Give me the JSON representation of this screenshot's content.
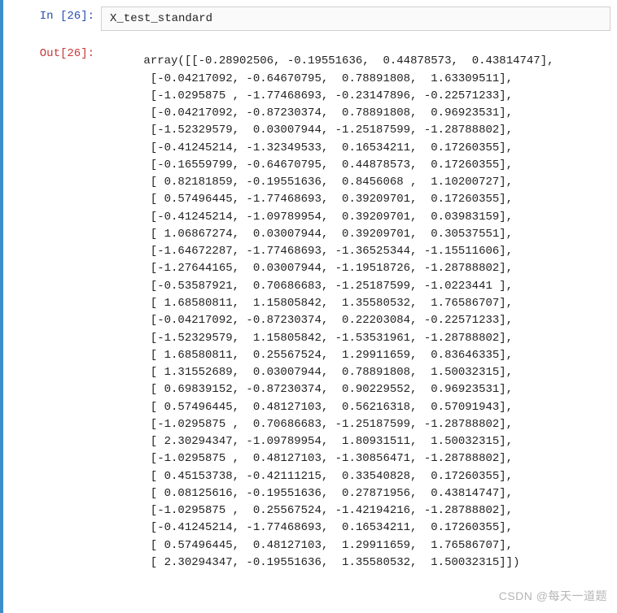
{
  "prompts": {
    "in_label": "In [26]:",
    "out_label": "Out[26]:"
  },
  "input_code": "X_test_standard",
  "output_prefix": "array([",
  "output_suffix": "])",
  "array_rows": [
    [
      -0.28902506,
      -0.19551636,
      0.44878573,
      0.43814747
    ],
    [
      -0.04217092,
      -0.64670795,
      0.78891808,
      1.63309511
    ],
    [
      -1.0295875,
      -1.77468693,
      -0.23147896,
      -0.22571233
    ],
    [
      -0.04217092,
      -0.87230374,
      0.78891808,
      0.96923531
    ],
    [
      -1.52329579,
      0.03007944,
      -1.25187599,
      -1.28788802
    ],
    [
      -0.41245214,
      -1.32349533,
      0.16534211,
      0.17260355
    ],
    [
      -0.16559799,
      -0.64670795,
      0.44878573,
      0.17260355
    ],
    [
      0.82181859,
      -0.19551636,
      0.8456068,
      1.10200727
    ],
    [
      0.57496445,
      -1.77468693,
      0.39209701,
      0.17260355
    ],
    [
      -0.41245214,
      -1.09789954,
      0.39209701,
      0.03983159
    ],
    [
      1.06867274,
      0.03007944,
      0.39209701,
      0.30537551
    ],
    [
      -1.64672287,
      -1.77468693,
      -1.36525344,
      -1.15511606
    ],
    [
      -1.27644165,
      0.03007944,
      -1.19518726,
      -1.28788802
    ],
    [
      -0.53587921,
      0.70686683,
      -1.25187599,
      -1.0223441
    ],
    [
      1.68580811,
      1.15805842,
      1.35580532,
      1.76586707
    ],
    [
      -0.04217092,
      -0.87230374,
      0.22203084,
      -0.22571233
    ],
    [
      -1.52329579,
      1.15805842,
      -1.53531961,
      -1.28788802
    ],
    [
      1.68580811,
      0.25567524,
      1.29911659,
      0.83646335
    ],
    [
      1.31552689,
      0.03007944,
      0.78891808,
      1.50032315
    ],
    [
      0.69839152,
      -0.87230374,
      0.90229552,
      0.96923531
    ],
    [
      0.57496445,
      0.48127103,
      0.56216318,
      0.57091943
    ],
    [
      -1.0295875,
      0.70686683,
      -1.25187599,
      -1.28788802
    ],
    [
      2.30294347,
      -1.09789954,
      1.80931511,
      1.50032315
    ],
    [
      -1.0295875,
      0.48127103,
      -1.30856471,
      -1.28788802
    ],
    [
      0.45153738,
      -0.42111215,
      0.33540828,
      0.17260355
    ],
    [
      0.08125616,
      -0.19551636,
      0.27871956,
      0.43814747
    ],
    [
      -1.0295875,
      0.25567524,
      -1.42194216,
      -1.28788802
    ],
    [
      -0.41245214,
      -1.77468693,
      0.16534211,
      0.17260355
    ],
    [
      0.57496445,
      0.48127103,
      1.29911659,
      1.76586707
    ],
    [
      2.30294347,
      -0.19551636,
      1.35580532,
      1.50032315
    ]
  ],
  "watermark": "CSDN @每天一道题"
}
